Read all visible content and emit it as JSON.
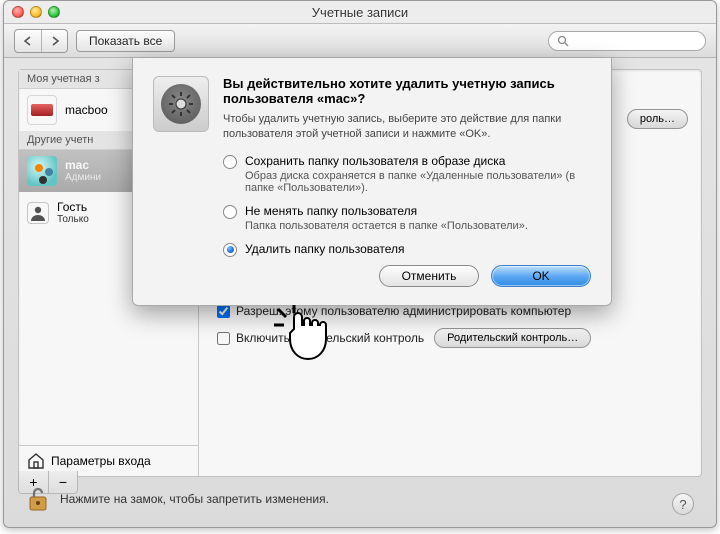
{
  "window": {
    "title": "Учетные записи"
  },
  "toolbar": {
    "show_all": "Показать все"
  },
  "sidebar": {
    "my_header": "Моя учетная з",
    "other_header": "Другие учетн",
    "accounts": [
      {
        "name": "macboo",
        "sub": ""
      },
      {
        "name": "mac",
        "sub": "Админи"
      },
      {
        "name": "Гость",
        "sub": "Только"
      }
    ],
    "login_params": "Параметры входа"
  },
  "right": {
    "change_password": "роль…",
    "admin_checkbox": "Разреш. этому пользователю администрировать компьютер",
    "parental_checkbox": "Включить Родительский контроль",
    "parental_button": "Родительский контроль…"
  },
  "sheet": {
    "heading": "Вы действительно хотите удалить учетную запись пользователя «mac»?",
    "subtext": "Чтобы удалить учетную запись, выберите это действие для папки пользователя этой учетной записи и нажмите «OK».",
    "options": [
      {
        "label": "Сохранить папку пользователя в образе диска",
        "desc": "Образ диска сохраняется в папке «Удаленные пользователи» (в папке «Пользователи»)."
      },
      {
        "label": "Не менять папку пользователя",
        "desc": "Папка пользователя остается в папке «Пользователи»."
      },
      {
        "label": "Удалить папку пользователя",
        "desc": ""
      }
    ],
    "selected_index": 2,
    "cancel": "Отменить",
    "ok": "OK"
  },
  "footer": {
    "lock_text": "Нажмите на замок, чтобы запретить изменения."
  }
}
